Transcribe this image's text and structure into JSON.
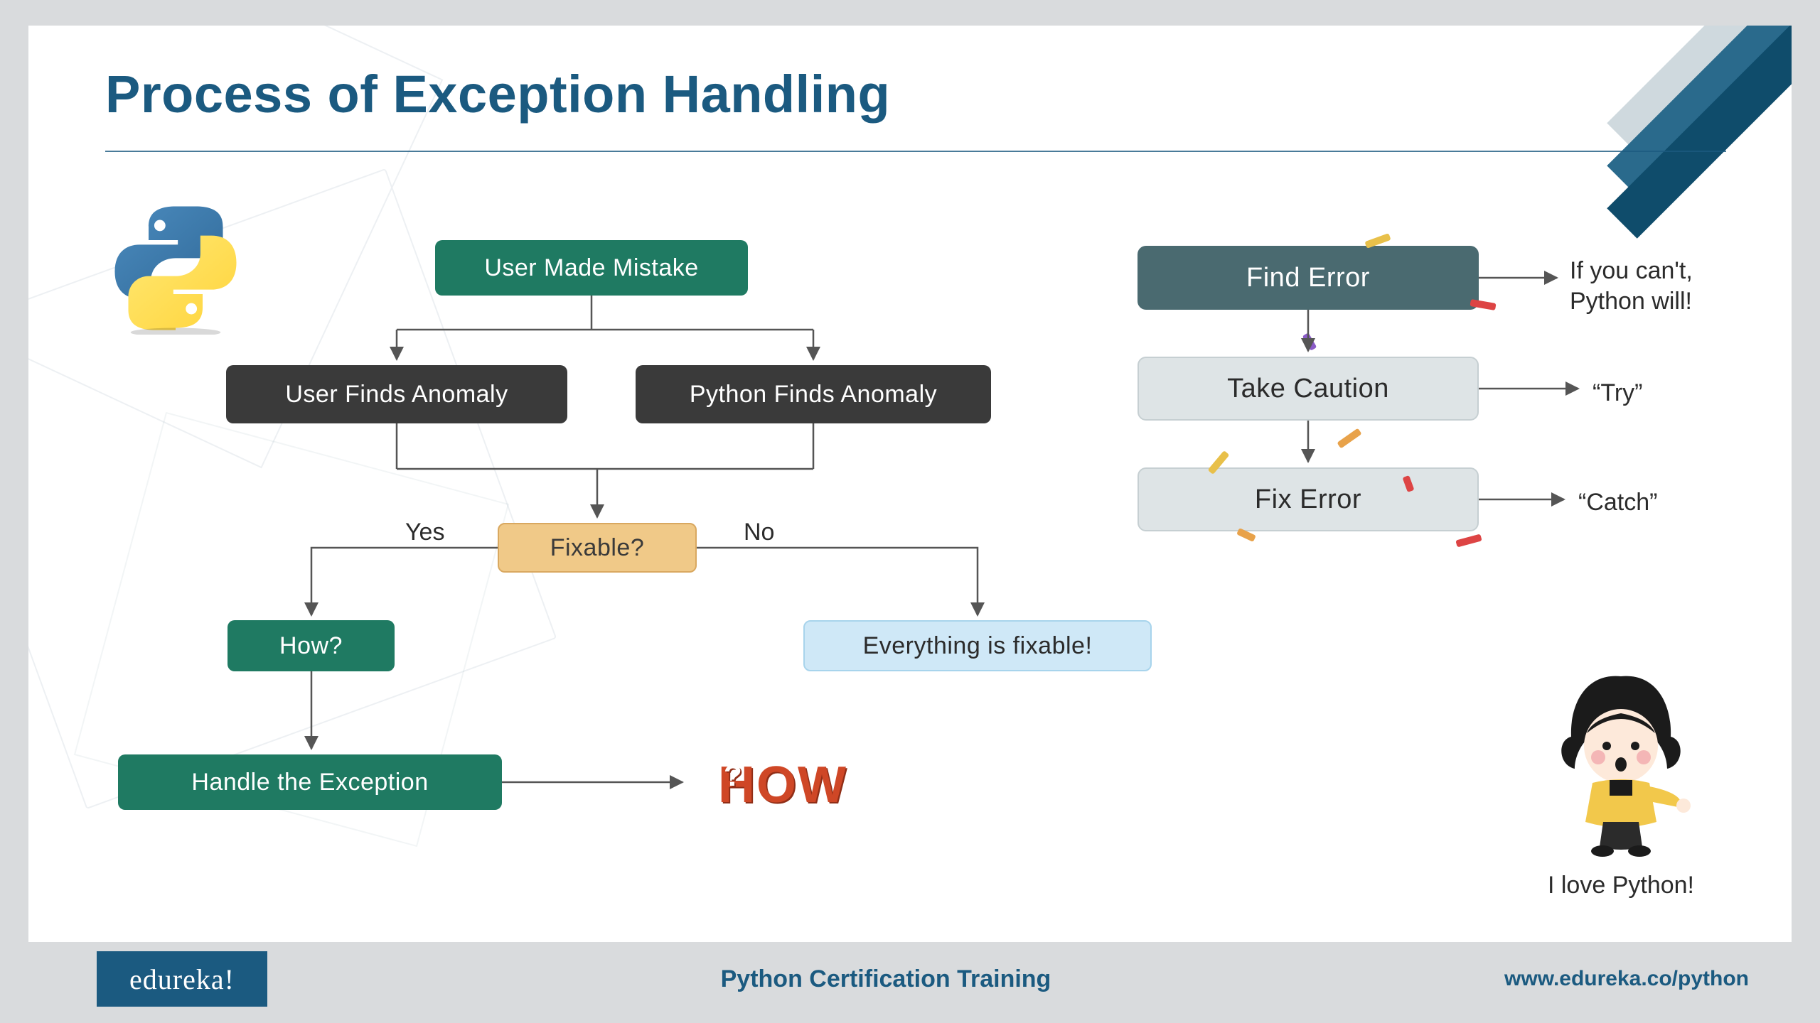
{
  "title": "Process of Exception Handling",
  "left_flow": {
    "user_made_mistake": "User Made Mistake",
    "user_finds_anomaly": "User Finds Anomaly",
    "python_finds_anomaly": "Python Finds Anomaly",
    "fixable": "Fixable?",
    "yes": "Yes",
    "no": "No",
    "how": "How?",
    "everything": "Everything is fixable!",
    "handle": "Handle the Exception",
    "how_graphic": "HOW"
  },
  "right_flow": {
    "find_error": "Find Error",
    "take_caution": "Take Caution",
    "fix_error": "Fix Error",
    "note_find": "If you can't,\nPython will!",
    "note_try": "“Try”",
    "note_catch": "“Catch”"
  },
  "character_caption": "I love Python!",
  "footer": {
    "brand": "edureka!",
    "course": "Python Certification Training",
    "url": "www.edureka.co/python"
  }
}
